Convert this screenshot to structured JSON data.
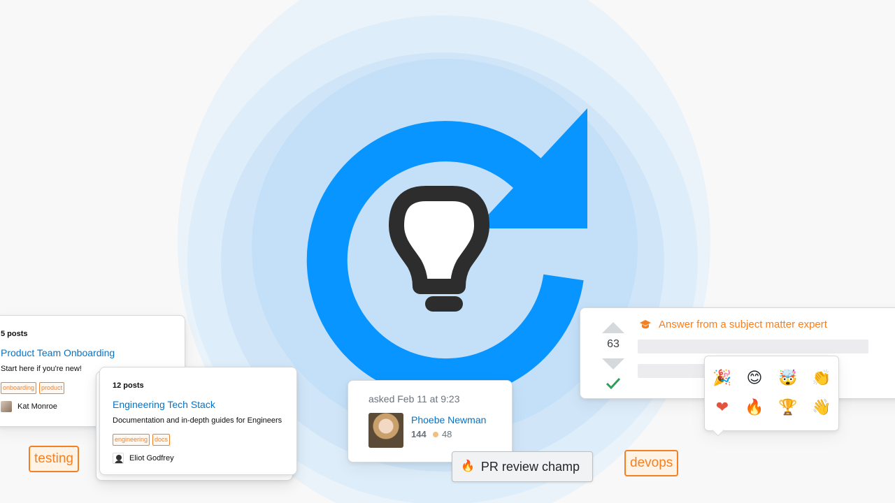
{
  "collective_card_1": {
    "posts": "5 posts",
    "title": "Product Team Onboarding",
    "description": "Start here if you're new!",
    "tags": [
      "onboarding",
      "product"
    ],
    "author": "Kat Monroe"
  },
  "collective_card_2": {
    "posts": "12 posts",
    "title": "Engineering Tech Stack",
    "description": "Documentation and in-depth guides for Engineers",
    "tags": [
      "engineering",
      "docs"
    ],
    "author": "Eliot Godfrey"
  },
  "tags": {
    "testing": "testing",
    "devops": "devops"
  },
  "asked_card": {
    "asked": "asked Feb 11 at 9:23",
    "user_name": "Phoebe Newman",
    "reputation": "144",
    "bronze_badges": "48"
  },
  "badge": {
    "label": "PR review champ"
  },
  "answer_card": {
    "heading": "Answer from a subject matter expert",
    "score": "63"
  },
  "reactions": {
    "items": [
      "party-popper",
      "smile",
      "mind-blown",
      "clap",
      "heart",
      "fire",
      "trophy",
      "wave"
    ]
  },
  "colors": {
    "accent_blue": "#0995ff",
    "link_blue": "#0074cc",
    "orange": "#f48024",
    "accepted_green": "#2f9e5a",
    "ring_light": "#e3effa",
    "ring_mid": "#d3e7f8",
    "ring_inner": "#bfdff7"
  }
}
